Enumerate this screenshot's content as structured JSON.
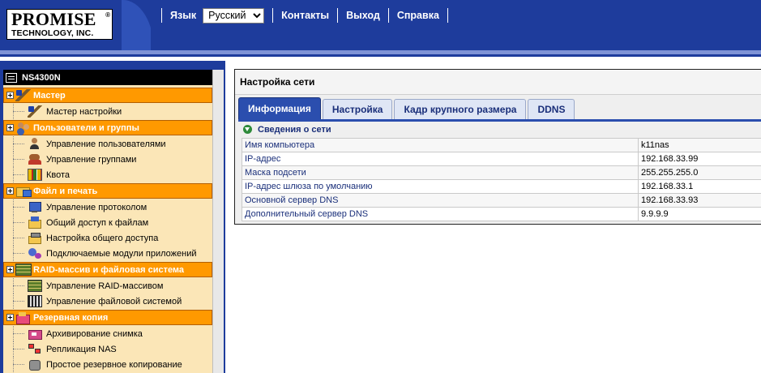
{
  "header": {
    "logo": {
      "line1": "PROMISE",
      "registered": "®",
      "line2": "TECHNOLOGY, INC."
    },
    "nav": {
      "language_label": "Язык",
      "language_selected": "Русский",
      "contacts": "Контакты",
      "logout": "Выход",
      "help": "Справка"
    }
  },
  "sidebar": {
    "device_name": "NS4300N",
    "groups": [
      {
        "label": "Мастер",
        "items": [
          "Мастер настройки"
        ]
      },
      {
        "label": "Пользователи и группы",
        "items": [
          "Управление пользователями",
          "Управление группами",
          "Квота"
        ]
      },
      {
        "label": "Файл и печать",
        "items": [
          "Управление протоколом",
          "Общий доступ к файлам",
          "Настройка общего доступа",
          "Подключаемые модули приложений"
        ]
      },
      {
        "label": "RAID-массив и файловая система",
        "items": [
          "Управление RAID-массивом",
          "Управление файловой системой"
        ]
      },
      {
        "label": "Резервная копия",
        "items": [
          "Архивирование снимка",
          "Репликация NAS",
          "Простое резервное копирование"
        ]
      }
    ]
  },
  "main": {
    "title": "Настройка сети",
    "tabs": [
      "Информация",
      "Настройка",
      "Кадр крупного размера",
      "DDNS"
    ],
    "active_tab": "Информация",
    "section_title": "Сведения о сети",
    "rows": [
      {
        "label": "Имя компьютера",
        "value": "k11nas"
      },
      {
        "label": "IP-адрес",
        "value": "192.168.33.99"
      },
      {
        "label": "Маска подсети",
        "value": "255.255.255.0"
      },
      {
        "label": "IP-адрес шлюза по умолчанию",
        "value": "192.168.33.1"
      },
      {
        "label": "Основной сервер DNS",
        "value": "192.168.33.93"
      },
      {
        "label": "Дополнительный сервер DNS",
        "value": "9.9.9.9"
      }
    ]
  },
  "colors": {
    "header_blue": "#1e3c9c",
    "group_orange": "#ff9900",
    "sidebar_bg": "#fbe6b7",
    "tab_active": "#2b4eae"
  }
}
